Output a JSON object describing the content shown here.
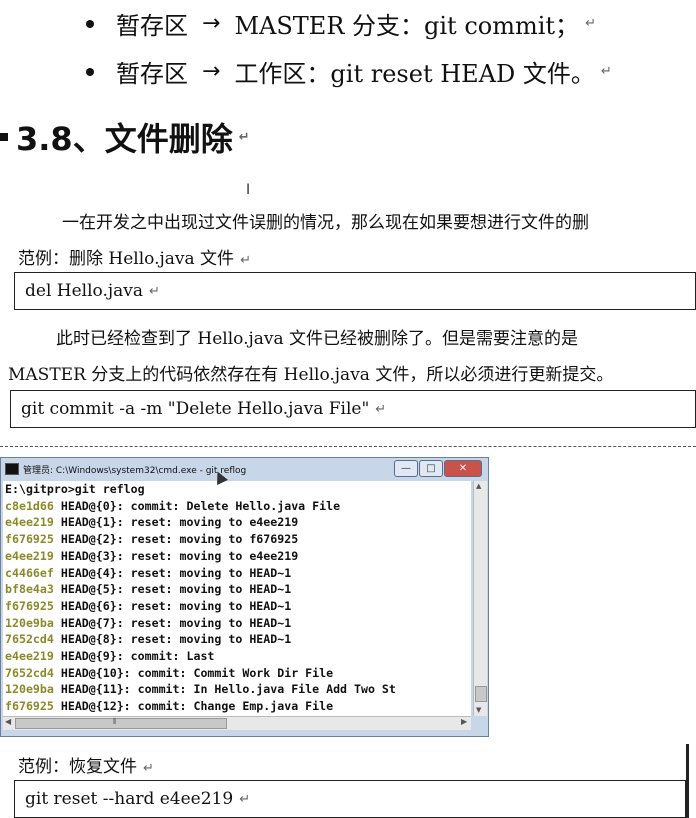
{
  "bullets": [
    {
      "left": "暂存区",
      "arrow": "→",
      "right": "MASTER 分支：git commit；"
    },
    {
      "left": "暂存区",
      "arrow": "→",
      "right": "工作区：git reset HEAD  文件。"
    }
  ],
  "para_mark": "↵",
  "heading": "3.8、文件删除",
  "intro": "一在开发之中出现过文件误删的情况，那么现在如果要想进行文件的删",
  "example1_label": "范例：删除 Hello.java 文件",
  "code1": "del Hello.java",
  "explain_line1": "此时已经检查到了 Hello.java  文件已经被删除了。但是需要注意的是",
  "explain_line2": "MASTER 分支上的代码依然存在有 Hello.java 文件，所以必须进行更新提交。",
  "code2": "git commit -a -m \"Delete Hello.java File\"",
  "cmd": {
    "title": "管理员: C:\\Windows\\system32\\cmd.exe - git  reflog",
    "prompt": "E:\\gitpro>git reflog",
    "lines": [
      {
        "hash": "c8e1d66",
        "rest": " HEAD@{0}: commit: Delete Hello.java File"
      },
      {
        "hash": "e4ee219",
        "rest": " HEAD@{1}: reset: moving to e4ee219"
      },
      {
        "hash": "f676925",
        "rest": " HEAD@{2}: reset: moving to f676925"
      },
      {
        "hash": "e4ee219",
        "rest": " HEAD@{3}: reset: moving to e4ee219"
      },
      {
        "hash": "c4466ef",
        "rest": " HEAD@{4}: reset: moving to HEAD~1"
      },
      {
        "hash": "bf8e4a3",
        "rest": " HEAD@{5}: reset: moving to HEAD~1"
      },
      {
        "hash": "f676925",
        "rest": " HEAD@{6}: reset: moving to HEAD~1"
      },
      {
        "hash": "120e9ba",
        "rest": " HEAD@{7}: reset: moving to HEAD~1"
      },
      {
        "hash": "7652cd4",
        "rest": " HEAD@{8}: reset: moving to HEAD~1"
      },
      {
        "hash": "e4ee219",
        "rest": " HEAD@{9}: commit: Last"
      },
      {
        "hash": "7652cd4",
        "rest": " HEAD@{10}: commit: Commit Work Dir File"
      },
      {
        "hash": "120e9ba",
        "rest": " HEAD@{11}: commit: In Hello.java File Add Two St"
      },
      {
        "hash": "f676925",
        "rest": " HEAD@{12}: commit: Change Emp.java File"
      }
    ],
    "btn_min": "—",
    "btn_max": "□",
    "btn_close": "✕",
    "hash_color": "#8a8a2a"
  },
  "example2_label": "范例：恢复文件",
  "code3": "git reset --hard e4ee219"
}
